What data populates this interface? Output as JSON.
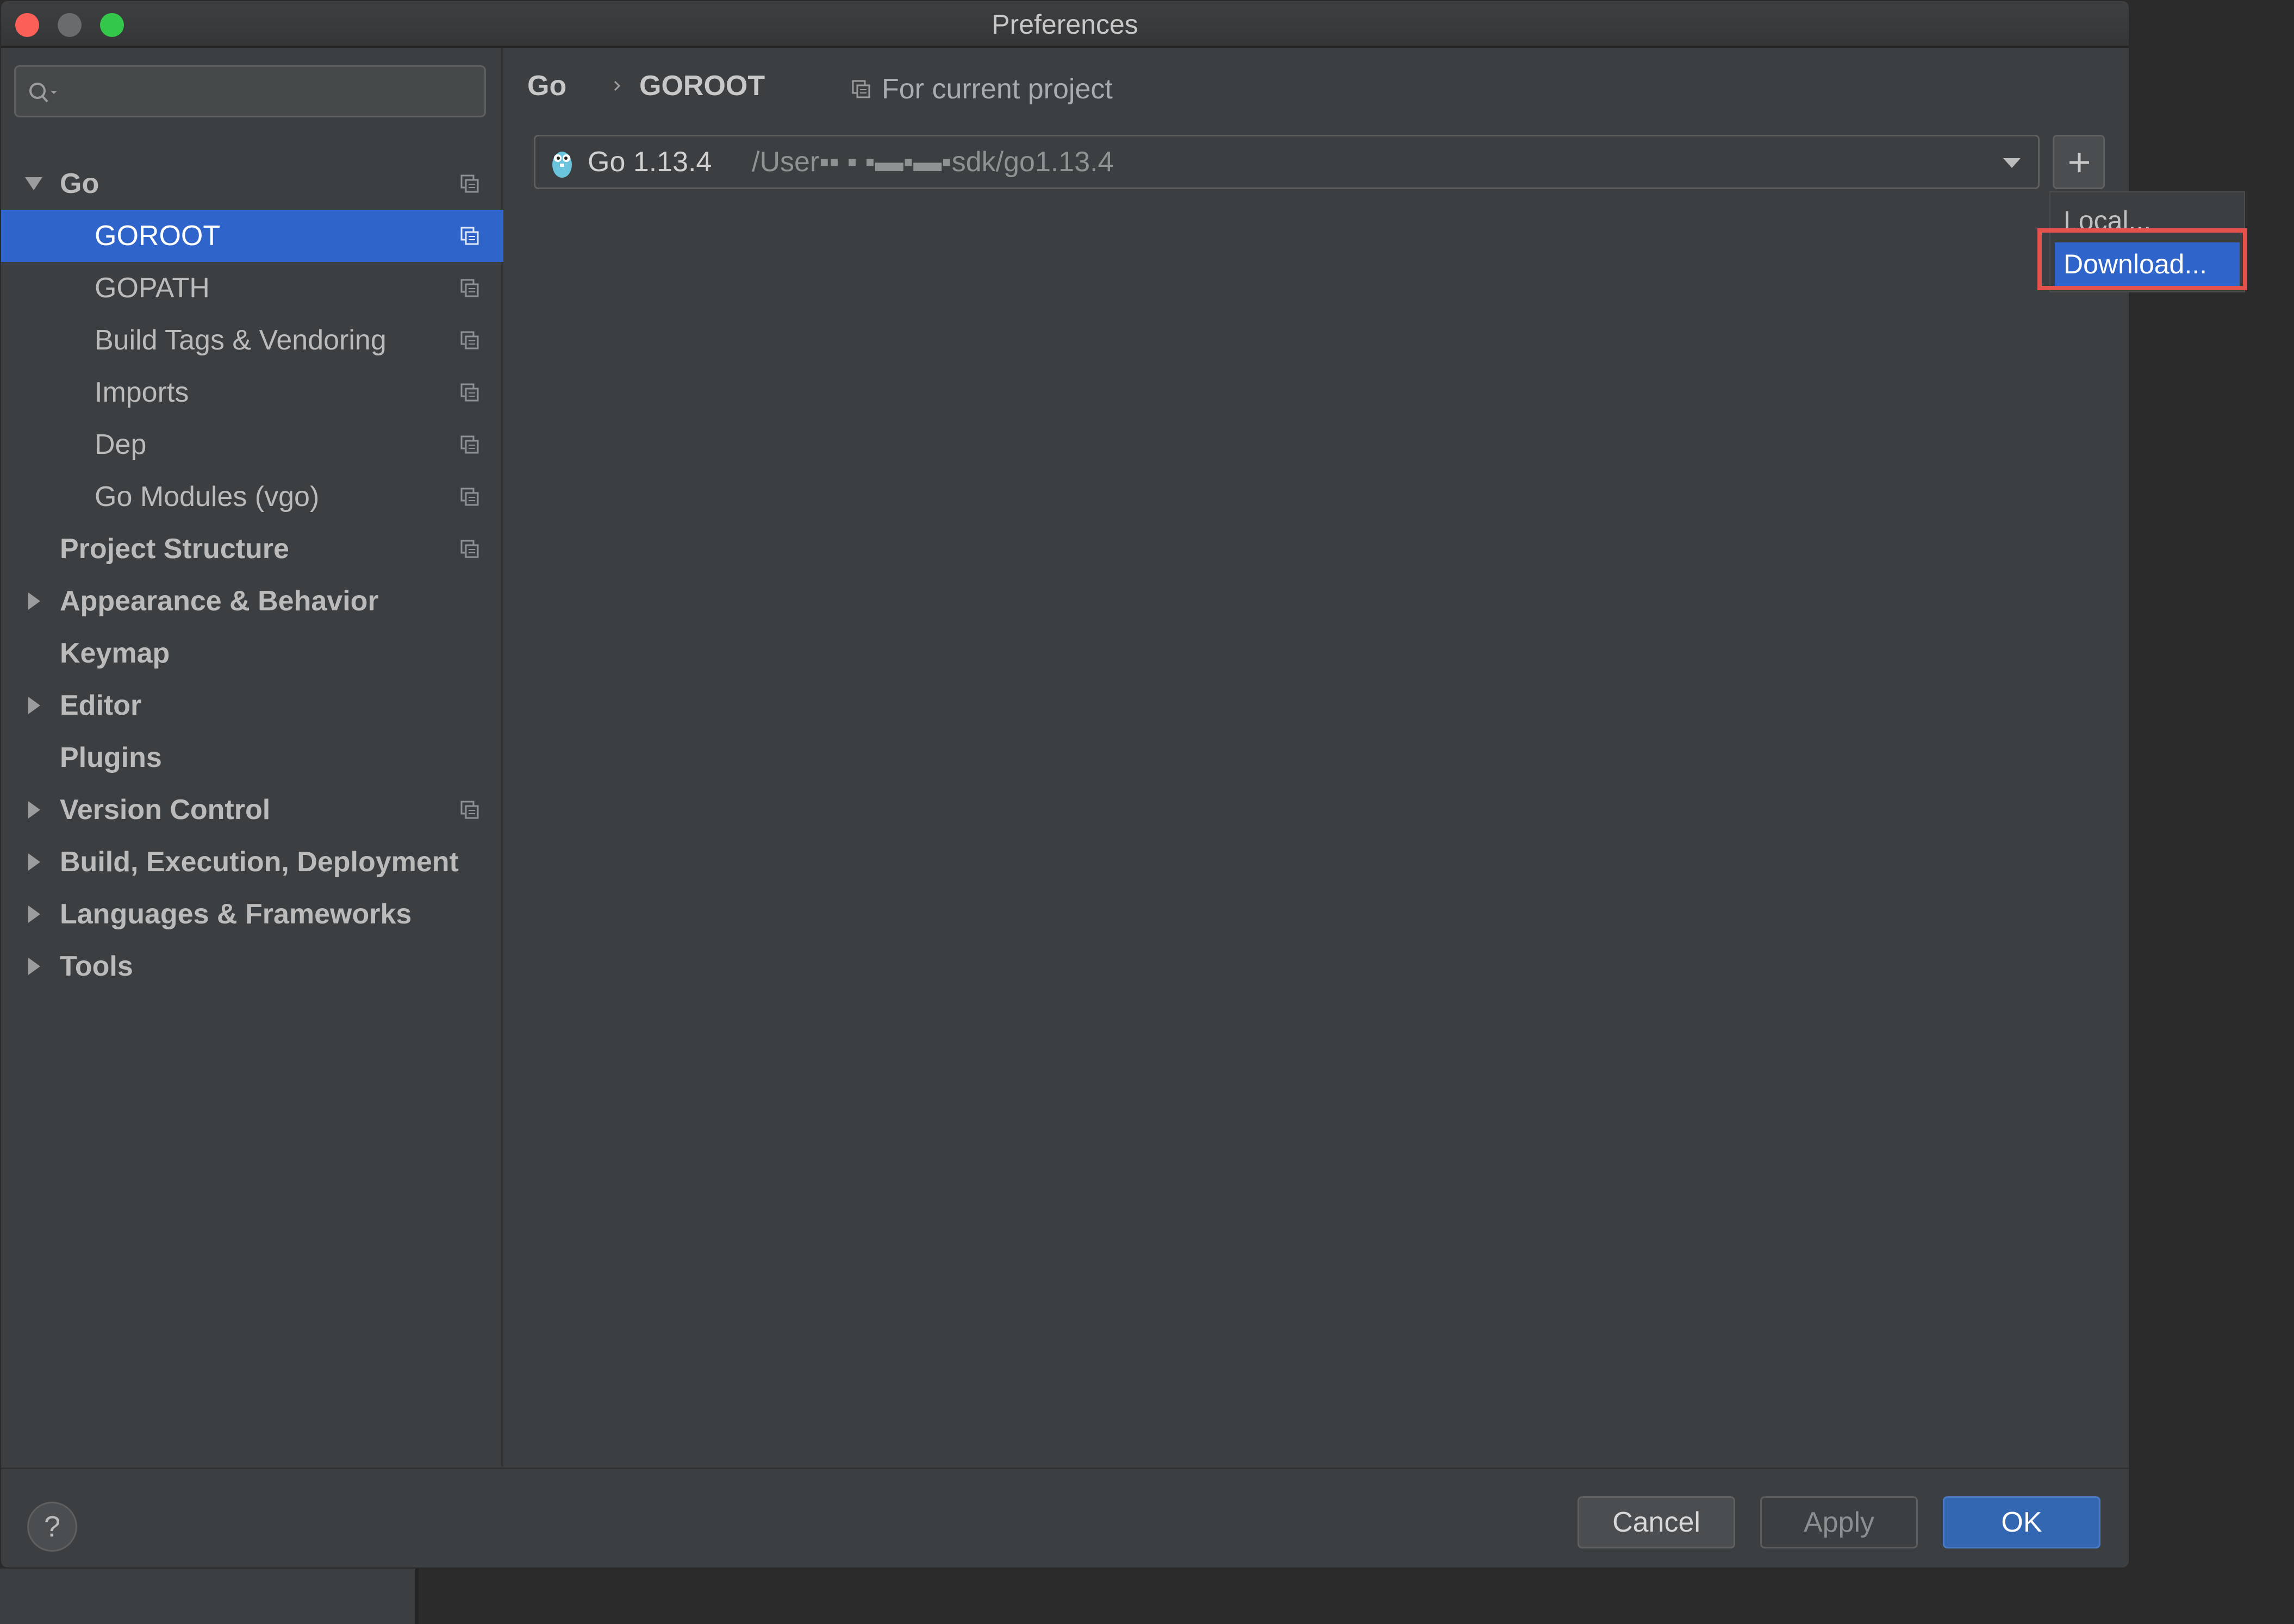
{
  "window": {
    "title": "Preferences"
  },
  "search": {
    "placeholder": "",
    "value": ""
  },
  "sidebar": {
    "items": [
      {
        "label": "Go",
        "level": 0,
        "bold": true,
        "expanded": true,
        "scoped": true
      },
      {
        "label": "GOROOT",
        "level": 1,
        "selected": true,
        "scoped": true
      },
      {
        "label": "GOPATH",
        "level": 1,
        "scoped": true
      },
      {
        "label": "Build Tags & Vendoring",
        "level": 1,
        "scoped": true
      },
      {
        "label": "Imports",
        "level": 1,
        "scoped": true
      },
      {
        "label": "Dep",
        "level": 1,
        "scoped": true
      },
      {
        "label": "Go Modules (vgo)",
        "level": 1,
        "scoped": true
      },
      {
        "label": "Project Structure",
        "level": 0,
        "bold": true,
        "scoped": true
      },
      {
        "label": "Appearance & Behavior",
        "level": 0,
        "bold": true,
        "collapsed": true
      },
      {
        "label": "Keymap",
        "level": 0,
        "bold": true
      },
      {
        "label": "Editor",
        "level": 0,
        "bold": true,
        "collapsed": true
      },
      {
        "label": "Plugins",
        "level": 0,
        "bold": true
      },
      {
        "label": "Version Control",
        "level": 0,
        "bold": true,
        "collapsed": true,
        "scoped": true
      },
      {
        "label": "Build, Execution, Deployment",
        "level": 0,
        "bold": true,
        "collapsed": true
      },
      {
        "label": "Languages & Frameworks",
        "level": 0,
        "bold": true,
        "collapsed": true
      },
      {
        "label": "Tools",
        "level": 0,
        "bold": true,
        "collapsed": true
      }
    ]
  },
  "breadcrumb": {
    "parent": "Go",
    "current": "GOROOT"
  },
  "scope": {
    "label": "For current project"
  },
  "sdk": {
    "name": "Go 1.13.4",
    "path": "/User▪▪ ▪ ▪▬▪▬▪sdk/go1.13.4"
  },
  "add_button": {
    "label": "+"
  },
  "popup": {
    "local": "Local...",
    "download": "Download..."
  },
  "footer": {
    "help": "?",
    "cancel": "Cancel",
    "apply": "Apply",
    "ok": "OK"
  },
  "colors": {
    "selection": "#2f65ca",
    "highlight": "#e5524c",
    "ok": "#3467b2"
  }
}
